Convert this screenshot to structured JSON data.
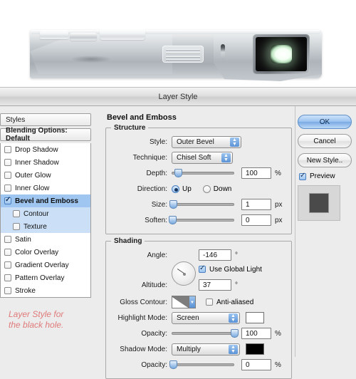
{
  "photo": {
    "description": "silver compact camera side view",
    "viewfinder_name": "black-hole-viewfinder"
  },
  "dialog": {
    "title": "Layer Style"
  },
  "styles_panel": {
    "header": "Styles",
    "blending_options": "Blending Options: Default",
    "items": [
      {
        "label": "Drop Shadow",
        "checked": false,
        "selected": false,
        "sub": false
      },
      {
        "label": "Inner Shadow",
        "checked": false,
        "selected": false,
        "sub": false
      },
      {
        "label": "Outer Glow",
        "checked": false,
        "selected": false,
        "sub": false
      },
      {
        "label": "Inner Glow",
        "checked": false,
        "selected": false,
        "sub": false
      },
      {
        "label": "Bevel and Emboss",
        "checked": true,
        "selected": true,
        "sub": false
      },
      {
        "label": "Contour",
        "checked": false,
        "selected": false,
        "sub": true
      },
      {
        "label": "Texture",
        "checked": false,
        "selected": false,
        "sub": true
      },
      {
        "label": "Satin",
        "checked": false,
        "selected": false,
        "sub": false
      },
      {
        "label": "Color Overlay",
        "checked": false,
        "selected": false,
        "sub": false
      },
      {
        "label": "Gradient Overlay",
        "checked": false,
        "selected": false,
        "sub": false
      },
      {
        "label": "Pattern Overlay",
        "checked": false,
        "selected": false,
        "sub": false
      },
      {
        "label": "Stroke",
        "checked": false,
        "selected": false,
        "sub": false
      }
    ]
  },
  "annotation": {
    "line1": "Layer Style for",
    "line2": "the black hole.",
    "color": "#e07a7a"
  },
  "main": {
    "section_title": "Bevel and Emboss",
    "structure": {
      "legend": "Structure",
      "style_label": "Style:",
      "style_value": "Outer Bevel",
      "technique_label": "Technique:",
      "technique_value": "Chisel Soft",
      "depth_label": "Depth:",
      "depth_value": "100",
      "depth_unit": "%",
      "depth_pct": 10,
      "direction_label": "Direction:",
      "direction_up": "Up",
      "direction_down": "Down",
      "direction_selected": "Up",
      "size_label": "Size:",
      "size_value": "1",
      "size_unit": "px",
      "size_pct": 2,
      "soften_label": "Soften:",
      "soften_value": "0",
      "soften_unit": "px",
      "soften_pct": 1
    },
    "shading": {
      "legend": "Shading",
      "angle_label": "Angle:",
      "angle_value": "-146",
      "angle_unit": "°",
      "use_global_light_label": "Use Global Light",
      "use_global_light": true,
      "altitude_label": "Altitude:",
      "altitude_value": "37",
      "altitude_unit": "°",
      "gloss_contour_label": "Gloss Contour:",
      "anti_aliased_label": "Anti-aliased",
      "anti_aliased": false,
      "highlight_mode_label": "Highlight Mode:",
      "highlight_mode_value": "Screen",
      "highlight_color": "#ffffff",
      "highlight_opacity_label": "Opacity:",
      "highlight_opacity_value": "100",
      "highlight_opacity_unit": "%",
      "highlight_opacity_pct": 100,
      "shadow_mode_label": "Shadow Mode:",
      "shadow_mode_value": "Multiply",
      "shadow_color": "#000000",
      "shadow_opacity_label": "Opacity:",
      "shadow_opacity_value": "0",
      "shadow_opacity_unit": "%",
      "shadow_opacity_pct": 2
    }
  },
  "right": {
    "ok": "OK",
    "cancel": "Cancel",
    "new_style": "New Style..",
    "preview_label": "Preview",
    "preview_checked": true,
    "preview_color": "#4a4a4a"
  }
}
